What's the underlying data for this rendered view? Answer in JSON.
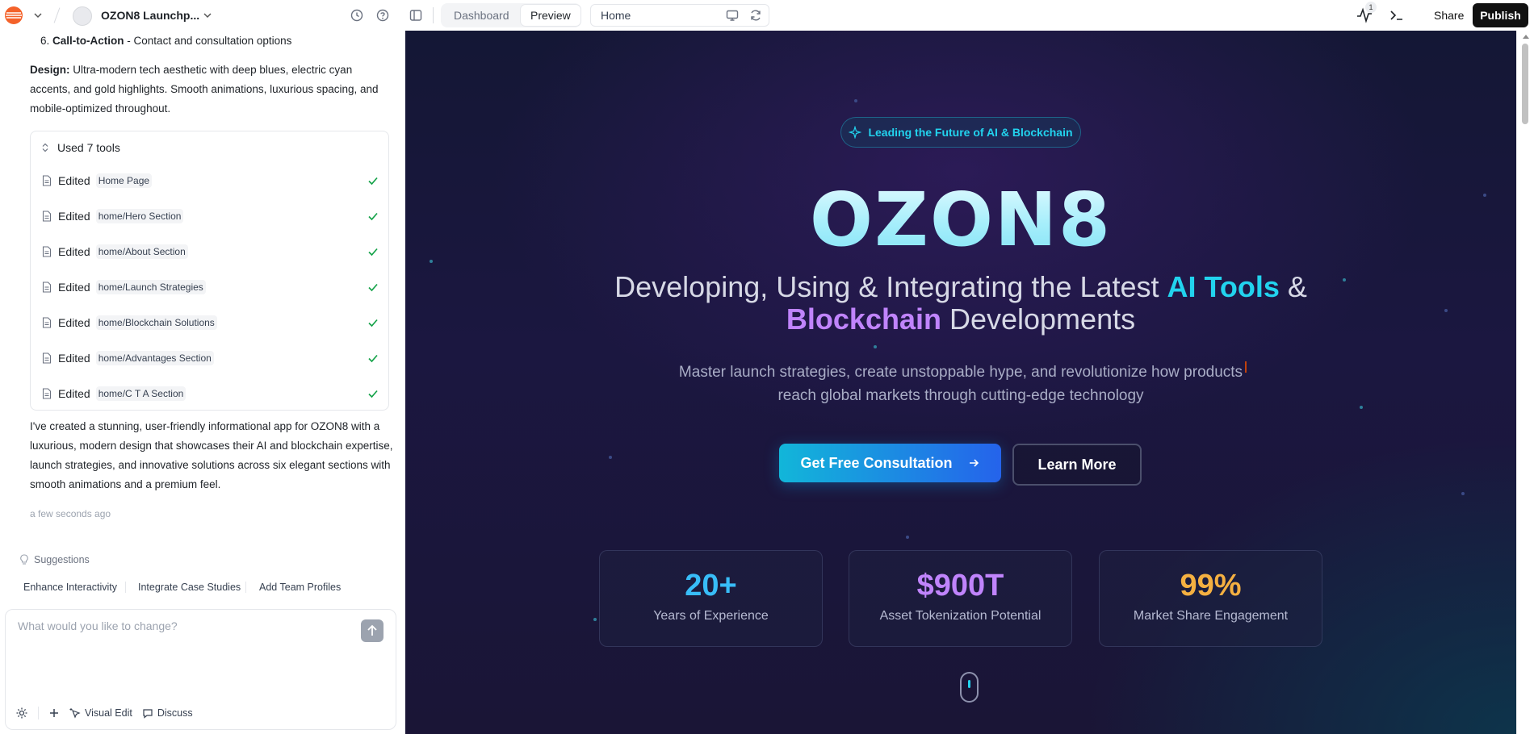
{
  "topbar": {
    "project_name": "OZON8 Launchp...",
    "tabs": [
      {
        "label": "Dashboard"
      },
      {
        "label": "Preview"
      }
    ],
    "active_tab": "Preview",
    "url_value": "Home",
    "activity_badge": "1",
    "share_label": "Share",
    "publish_label": "Publish"
  },
  "chat": {
    "cta_item": {
      "number": "6.",
      "title": "Call-to-Action",
      "desc": "- Contact and consultation options"
    },
    "design": {
      "label": "Design:",
      "text": "Ultra-modern tech aesthetic with deep blues, electric cyan accents, and gold highlights. Smooth animations, luxurious spacing, and mobile-optimized throughout."
    },
    "tools_header": "Used 7 tools",
    "tools": [
      {
        "verb": "Edited",
        "target": "Home Page"
      },
      {
        "verb": "Edited",
        "target": "home/Hero Section"
      },
      {
        "verb": "Edited",
        "target": "home/About Section"
      },
      {
        "verb": "Edited",
        "target": "home/Launch Strategies"
      },
      {
        "verb": "Edited",
        "target": "home/Blockchain Solutions"
      },
      {
        "verb": "Edited",
        "target": "home/Advantages Section"
      },
      {
        "verb": "Edited",
        "target": "home/C T A Section"
      }
    ],
    "summary": "I've created a stunning, user-friendly informational app for OZON8 with a luxurious, modern design that showcases their AI and blockchain expertise, launch strategies, and innovative solutions across six elegant sections with smooth animations and a premium feel.",
    "timestamp": "a few seconds ago",
    "suggestions_label": "Suggestions",
    "suggestions": [
      {
        "label": "Enhance Interactivity"
      },
      {
        "label": "Integrate Case Studies"
      },
      {
        "label": "Add Team Profiles"
      }
    ],
    "composer_placeholder": "What would you like to change?",
    "visual_edit_label": "Visual Edit",
    "discuss_label": "Discuss"
  },
  "preview": {
    "pill_text": "Leading the Future of AI & Blockchain",
    "title": "OZON8",
    "subtitle_part1": "Developing, Using & Integrating the Latest ",
    "subtitle_hl1": "AI Tools",
    "subtitle_part2": " & ",
    "subtitle_hl2": "Blockchain",
    "subtitle_part3": " Developments",
    "description_line1": "Master launch strategies, create unstoppable hype, and revolutionize how products",
    "description_line2": "reach global markets through cutting-edge technology",
    "cta_primary": "Get Free Consultation",
    "cta_secondary": "Learn More",
    "stats": [
      {
        "value": "20+",
        "label": "Years of Experience",
        "color": "#38bdf8"
      },
      {
        "value": "$900T",
        "label": "Asset Tokenization Potential",
        "color": "#c084fc"
      },
      {
        "value": "99%",
        "label": "Market Share Engagement",
        "color": "#f5b041"
      }
    ]
  },
  "colors": {
    "accent_cyan": "#22d3ee",
    "accent_purple": "#c084fc",
    "accent_gold": "#f5b041",
    "check_green": "#16a34a",
    "publish_bg": "#111111"
  }
}
